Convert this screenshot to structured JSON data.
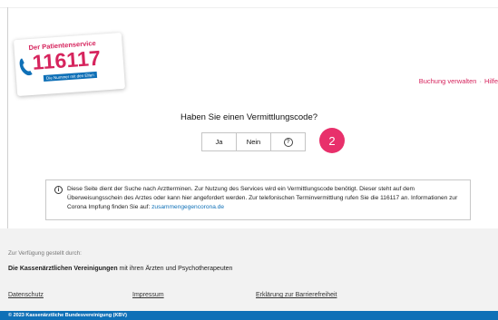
{
  "logo": {
    "title": "Der Patientenservice",
    "number": "116117",
    "tagline": "Die Nummer mit den Elfen",
    "phone_icon": "phone-icon"
  },
  "header": {
    "links": [
      "Buchung verwalten",
      "Hilfe"
    ]
  },
  "booking": {
    "question": "Haben Sie einen Vermittlungscode?",
    "yes_label": "Ja",
    "no_label": "Nein",
    "help_label": "?",
    "step_badge": "2"
  },
  "info": {
    "text": "Diese Seite dient der Suche nach Arztterminen. Zur Nutzung des Services wird ein Vermittlungscode benötigt. Dieser steht auf dem Überweisungsschein des Arztes oder kann hier angefordert werden. Zur telefonischen Terminvermittlung rufen Sie die 116117 an. Informationen zur Corona Impfung finden Sie auf:",
    "link": "zusammengegencorona.de",
    "icon": "info-icon"
  },
  "footer": {
    "provided_by": "Zur Verfügung gestellt durch:",
    "org_bold": "Die Kassenärztlichen Vereinigungen",
    "org_rest": "mit ihren Ärzten und Psychotherapeuten",
    "links": [
      "Datenschutz",
      "Impressum",
      "Erklärung zur Barrierefreiheit"
    ],
    "copyright": "© 2023 Kassenärztliche Bundesvereinigung (KBV)"
  },
  "colors": {
    "brand_pink": "#d6245d",
    "brand_blue": "#0f70b7",
    "badge": "#e8306b"
  }
}
